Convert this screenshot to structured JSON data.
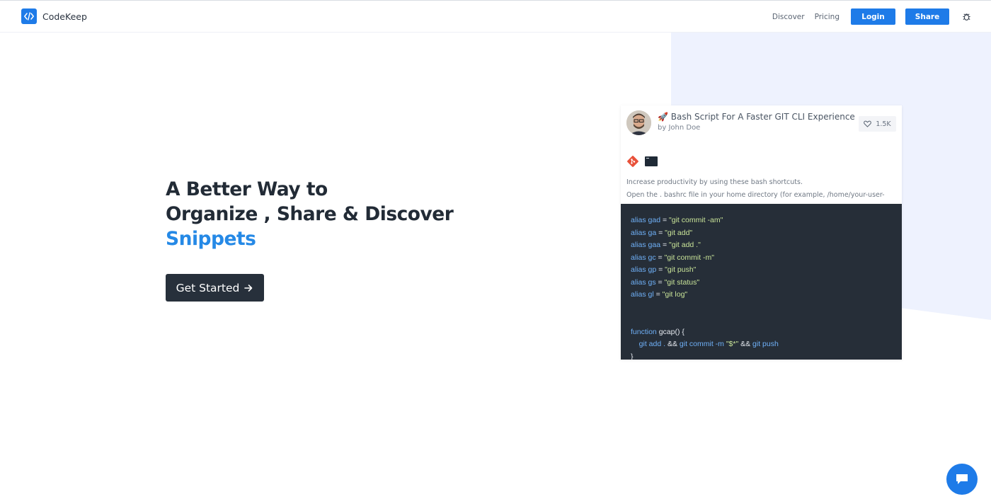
{
  "header": {
    "brand_name": "CodeKeep",
    "nav": {
      "discover": "Discover",
      "pricing": "Pricing",
      "login": "Login",
      "share": "Share"
    },
    "icons": [
      "code-logo-icon",
      "bug-icon"
    ]
  },
  "hero": {
    "line1": "A Better Way to",
    "line2": "Organize , Share & Discover",
    "line3": "Snippets",
    "cta_label": "Get Started"
  },
  "snippet_card": {
    "title": "Bash Script For A Faster GIT CLI Experience",
    "title_emoji": "🚀",
    "author": "by John Doe",
    "likes": "1.5K",
    "tags": [
      "git-icon",
      "terminal-icon"
    ],
    "description_lines": [
      "Increase productivity by using these bash shortcuts.",
      "Open the . bashrc file in your home directory (for example, /home/your-user-"
    ],
    "code_lines": [
      [
        [
          "k",
          "alias gad"
        ],
        [
          "w",
          " = "
        ],
        [
          "s",
          "\"git commit -am\""
        ]
      ],
      [
        [
          "k",
          "alias ga"
        ],
        [
          "w",
          " = "
        ],
        [
          "s",
          "\"git add\""
        ]
      ],
      [
        [
          "k",
          "alias gaa"
        ],
        [
          "w",
          " = "
        ],
        [
          "s",
          "\"git add .\""
        ]
      ],
      [
        [
          "k",
          "alias gc"
        ],
        [
          "w",
          " = "
        ],
        [
          "s",
          "\"git commit -m\""
        ]
      ],
      [
        [
          "k",
          "alias gp"
        ],
        [
          "w",
          " = "
        ],
        [
          "s",
          "\"git push\""
        ]
      ],
      [
        [
          "k",
          "alias gs"
        ],
        [
          "w",
          " = "
        ],
        [
          "s",
          "\"git status\""
        ]
      ],
      [
        [
          "k",
          "alias gl"
        ],
        [
          "w",
          " = "
        ],
        [
          "s",
          "\"git log\""
        ]
      ],
      [],
      [],
      [
        [
          "k",
          "function"
        ],
        [
          "w",
          " gcap() {"
        ]
      ],
      [
        [
          "w",
          "    "
        ],
        [
          "k",
          "git add ."
        ],
        [
          "w",
          " && "
        ],
        [
          "k",
          "git commit -m"
        ],
        [
          "w",
          " "
        ],
        [
          "s",
          "\"$*\""
        ],
        [
          "w",
          " && "
        ],
        [
          "k",
          "git push"
        ]
      ],
      [
        [
          "w",
          "}"
        ]
      ]
    ]
  },
  "colors": {
    "accent": "#1e7be8",
    "headline_accent": "#2589e6",
    "dark": "#222b36",
    "code_bg": "#262e38",
    "bg_shape": "#eef2fe"
  }
}
